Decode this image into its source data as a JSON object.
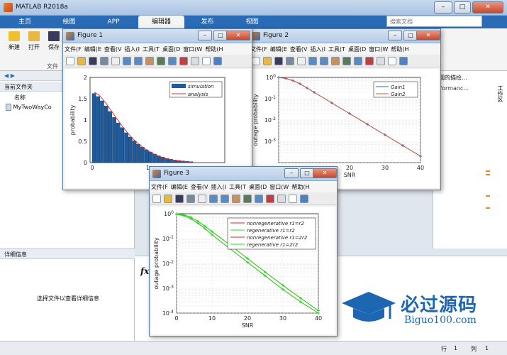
{
  "app": {
    "title": "MATLAB R2018a"
  },
  "ribbon_tabs": [
    "主页",
    "绘图",
    "APP",
    "编辑器",
    "发布",
    "视图"
  ],
  "ribbon_buttons": [
    "新建",
    "打开",
    "保存"
  ],
  "ribbon_group_label": "文件",
  "search": {
    "placeholder": "搜索文档"
  },
  "left_pane": {
    "title": "当前文件夹",
    "column_name": "名称",
    "file": "MyTwoWayCo",
    "details_title": "详细信息",
    "details_message": "选择文件以查看详细信息"
  },
  "right_pane": {
    "header": "rformanc...",
    "snippet": "圆的描绘...",
    "side_tab": "工作区"
  },
  "status": {
    "row_label": "行",
    "row_value": "1",
    "col_label": "列",
    "col_value": "1"
  },
  "fig_menu": [
    "文件(F",
    "编辑(E",
    "查看(V",
    "插入(I",
    "工具(T",
    "桌面(D",
    "窗口(W",
    "帮助(H"
  ],
  "figures": {
    "fig1": {
      "title": "Figure 1",
      "chart_data": {
        "type": "bar",
        "ylabel": "probability",
        "xlabel": "",
        "ylim": [
          0,
          2
        ],
        "yticks": [
          "0",
          "0.5",
          "1",
          "1.5",
          "2"
        ],
        "xticks": [
          "0",
          "1"
        ],
        "legend": [
          "simulation",
          "analysis"
        ],
        "bars": [
          1.62,
          1.55,
          1.45,
          1.33,
          1.2,
          1.06,
          0.93,
          0.82,
          0.7,
          0.6,
          0.51,
          0.43,
          0.36,
          0.3,
          0.25,
          0.2,
          0.16,
          0.13,
          0.1,
          0.08,
          0.06,
          0.05,
          0.04,
          0.03,
          0.02
        ],
        "analysis": [
          1.65,
          1.6,
          1.5,
          1.38,
          1.25,
          1.11,
          0.98,
          0.85,
          0.73,
          0.62,
          0.52,
          0.44,
          0.36,
          0.3,
          0.24,
          0.19,
          0.15,
          0.12,
          0.09,
          0.07,
          0.05,
          0.04,
          0.03,
          0.02,
          0.015
        ]
      }
    },
    "fig2": {
      "title": "Figure 2",
      "chart_data": {
        "type": "line",
        "xlabel": "SNR",
        "ylabel": "outage probability",
        "xlim": [
          0,
          40
        ],
        "ylim_log": [
          -4,
          0
        ],
        "xticks": [
          "20",
          "30",
          "40"
        ],
        "yticks": [
          "10^0",
          "10^-1",
          "10^-2",
          "10^-3"
        ],
        "legend": [
          "Gain1",
          "Gain2"
        ],
        "series": [
          {
            "name": "Gain1",
            "x": [
              0,
              2,
              4,
              6,
              8,
              10,
              15,
              20,
              25,
              30,
              35,
              40
            ],
            "log10y": [
              0,
              -0.05,
              -0.15,
              -0.3,
              -0.5,
              -0.7,
              -1.2,
              -1.7,
              -2.2,
              -2.7,
              -3.2,
              -3.7
            ]
          },
          {
            "name": "Gain2",
            "x": [
              0,
              2,
              4,
              6,
              8,
              10,
              15,
              20,
              25,
              30,
              35,
              40
            ],
            "log10y": [
              0,
              -0.05,
              -0.15,
              -0.3,
              -0.5,
              -0.7,
              -1.2,
              -1.7,
              -2.2,
              -2.7,
              -3.2,
              -3.7
            ]
          }
        ]
      }
    },
    "fig3": {
      "title": "Figure 3",
      "chart_data": {
        "type": "line",
        "xlabel": "SNR",
        "ylabel": "outage probability",
        "xlim": [
          0,
          40
        ],
        "ylim_log": [
          -4,
          0
        ],
        "xticks": [
          "0",
          "10",
          "20",
          "30",
          "40"
        ],
        "yticks": [
          "10^0",
          "10^-1",
          "10^-2",
          "10^-3",
          "10^-4"
        ],
        "legend": [
          "nonregenerative r1=r2",
          "regenerative r1=r2",
          "nonregenerative r1=2r2",
          "regenerative r1=2r2"
        ],
        "series": [
          {
            "name": "nonregenerative r1=r2",
            "x": [
              0,
              2,
              4,
              6,
              8,
              10,
              15,
              20,
              25,
              30,
              35,
              40
            ],
            "log10y": [
              0,
              -0.04,
              -0.14,
              -0.3,
              -0.5,
              -0.72,
              -1.25,
              -1.8,
              -2.35,
              -2.88,
              -3.4,
              -3.9
            ]
          },
          {
            "name": "regenerative r1=r2",
            "x": [
              0,
              2,
              4,
              6,
              8,
              10,
              15,
              20,
              25,
              30,
              35,
              40
            ],
            "log10y": [
              0,
              -0.04,
              -0.14,
              -0.3,
              -0.5,
              -0.72,
              -1.25,
              -1.8,
              -2.35,
              -2.88,
              -3.4,
              -3.9
            ]
          },
          {
            "name": "nonregenerative r1=2r2",
            "x": [
              0,
              2,
              4,
              6,
              8,
              10,
              15,
              20,
              25,
              30,
              35,
              40
            ],
            "log10y": [
              -0.02,
              -0.08,
              -0.2,
              -0.38,
              -0.6,
              -0.85,
              -1.4,
              -1.95,
              -2.5,
              -3.05,
              -3.55,
              -4.0
            ]
          },
          {
            "name": "regenerative r1=2r2",
            "x": [
              0,
              2,
              4,
              6,
              8,
              10,
              15,
              20,
              25,
              30,
              35,
              40
            ],
            "log10y": [
              -0.02,
              -0.08,
              -0.2,
              -0.38,
              -0.6,
              -0.85,
              -1.4,
              -1.95,
              -2.5,
              -3.05,
              -3.55,
              -4.0
            ]
          }
        ]
      }
    }
  },
  "watermark": {
    "cn": "必过源码",
    "en": "Biguo100.com"
  },
  "colors": {
    "ribbon_blue": "#2a6bb5",
    "bar_blue": "#1f5a9a",
    "analysis_red": "#e03030",
    "regen_green": "#22dd22"
  }
}
